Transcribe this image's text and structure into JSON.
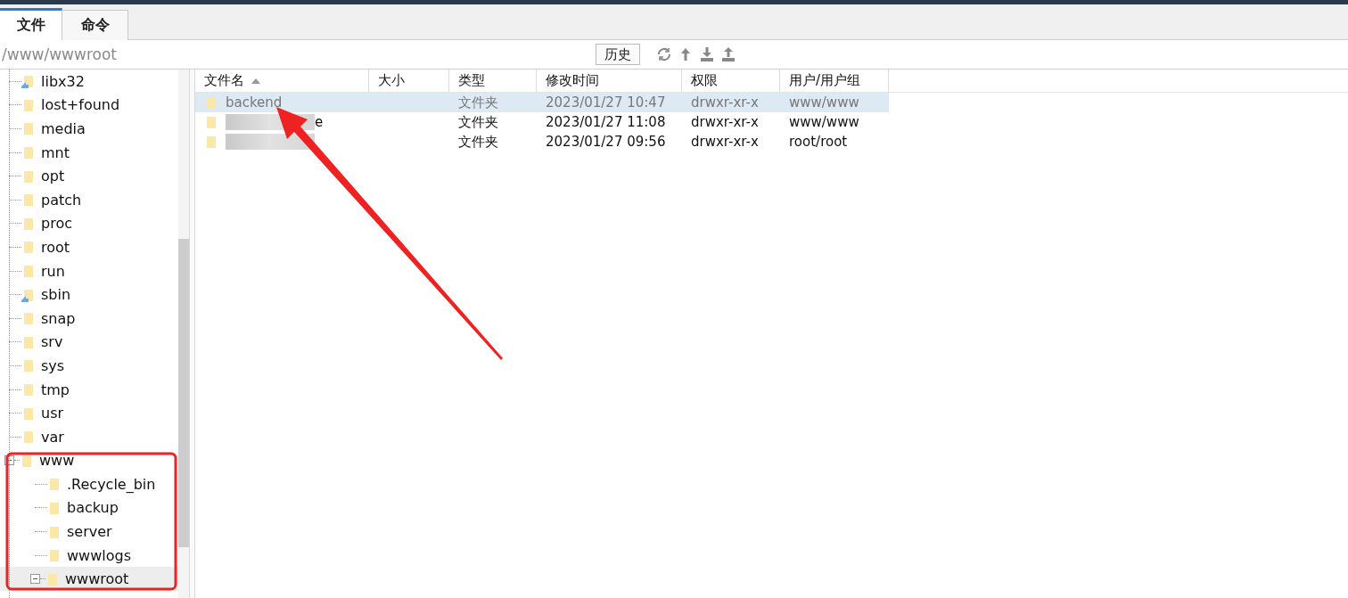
{
  "tabs": [
    {
      "label": "文件",
      "selected": true
    },
    {
      "label": "命令",
      "selected": false
    }
  ],
  "path_bar": {
    "path": "/www/wwwroot",
    "history_button": "历史"
  },
  "tree": [
    {
      "label": "libx32",
      "kind": "link",
      "selected": false
    },
    {
      "label": "lost+found",
      "kind": "folder",
      "selected": false
    },
    {
      "label": "media",
      "kind": "folder",
      "selected": false
    },
    {
      "label": "mnt",
      "kind": "folder",
      "selected": false
    },
    {
      "label": "opt",
      "kind": "folder",
      "selected": false
    },
    {
      "label": "patch",
      "kind": "folder",
      "selected": false
    },
    {
      "label": "proc",
      "kind": "folder",
      "selected": false
    },
    {
      "label": "root",
      "kind": "folder",
      "selected": false
    },
    {
      "label": "run",
      "kind": "folder",
      "selected": false
    },
    {
      "label": "sbin",
      "kind": "link",
      "selected": false
    },
    {
      "label": "snap",
      "kind": "folder",
      "selected": false
    },
    {
      "label": "srv",
      "kind": "folder",
      "selected": false
    },
    {
      "label": "sys",
      "kind": "folder",
      "selected": false
    },
    {
      "label": "tmp",
      "kind": "folder",
      "selected": false
    },
    {
      "label": "usr",
      "kind": "folder",
      "selected": false
    },
    {
      "label": "var",
      "kind": "folder",
      "selected": false
    },
    {
      "label": "www",
      "kind": "folder",
      "selected": false,
      "expanded": true,
      "children": [
        {
          "label": ".Recycle_bin",
          "kind": "folder",
          "selected": false
        },
        {
          "label": "backup",
          "kind": "folder",
          "selected": false
        },
        {
          "label": "server",
          "kind": "folder",
          "selected": false
        },
        {
          "label": "wwwlogs",
          "kind": "folder",
          "selected": false
        },
        {
          "label": "wwwroot",
          "kind": "folder",
          "selected": true,
          "expanded": true
        }
      ]
    }
  ],
  "table": {
    "columns": [
      "文件名",
      "大小",
      "类型",
      "修改时间",
      "权限",
      "用户/用户组"
    ],
    "rows": [
      {
        "name": "backend",
        "redacted": false,
        "selected": true,
        "type": "文件夹",
        "modified": "2023/01/27 10:47",
        "permissions": "drwxr-xr-x",
        "owner": "www/www"
      },
      {
        "name": "e",
        "redacted": true,
        "selected": false,
        "type": "文件夹",
        "modified": "2023/01/27 11:08",
        "permissions": "drwxr-xr-x",
        "owner": "www/www"
      },
      {
        "redacted": true,
        "selected": false,
        "type": "文件夹",
        "modified": "2023/01/27 09:56",
        "permissions": "drwxr-xr-x",
        "owner": "root/root"
      }
    ]
  }
}
